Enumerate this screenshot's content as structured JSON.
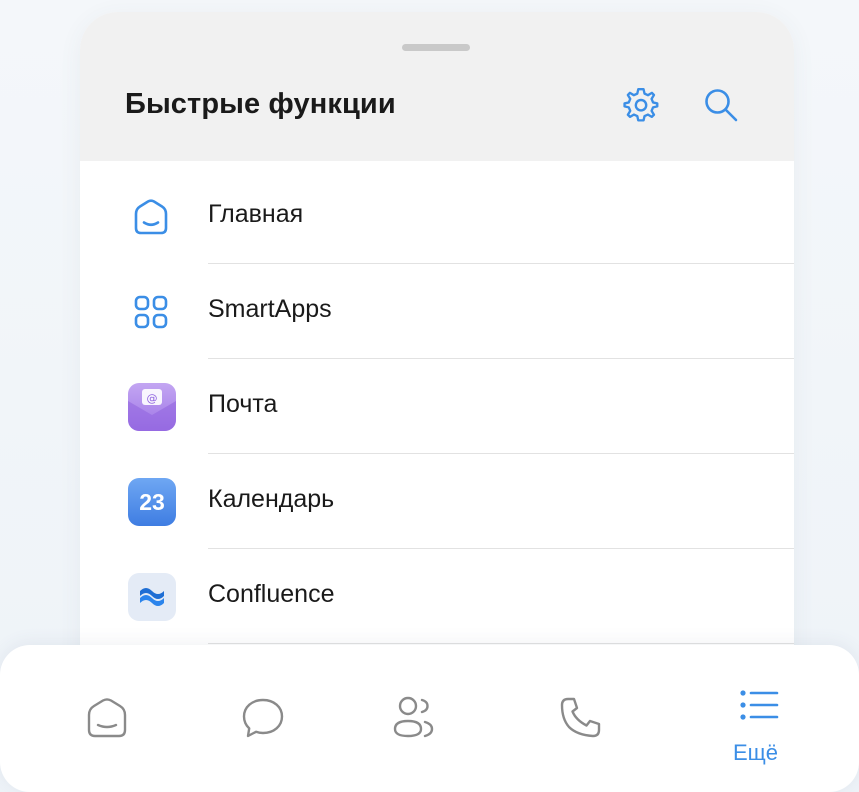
{
  "sheet": {
    "title": "Быстрые функции"
  },
  "header_icons": {
    "settings": "gear-icon",
    "search": "search-icon"
  },
  "quick_functions": [
    {
      "label": "Главная",
      "icon": "home-icon"
    },
    {
      "label": "SmartApps",
      "icon": "apps-grid-icon"
    },
    {
      "label": "Почта",
      "icon": "mail-app-icon"
    },
    {
      "label": "Календарь",
      "icon": "calendar-app-icon",
      "badge": "23"
    },
    {
      "label": "Confluence",
      "icon": "confluence-app-icon"
    }
  ],
  "tabbar": {
    "tabs": [
      {
        "icon": "home-icon"
      },
      {
        "icon": "chat-icon"
      },
      {
        "icon": "contacts-icon"
      },
      {
        "icon": "phone-icon"
      },
      {
        "icon": "menu-list-icon",
        "label": "Ещё",
        "active": true
      }
    ]
  },
  "colors": {
    "accent": "#3b8ee6",
    "icon_gray": "#8a8a8a",
    "header_bg": "#f1f1f1"
  }
}
